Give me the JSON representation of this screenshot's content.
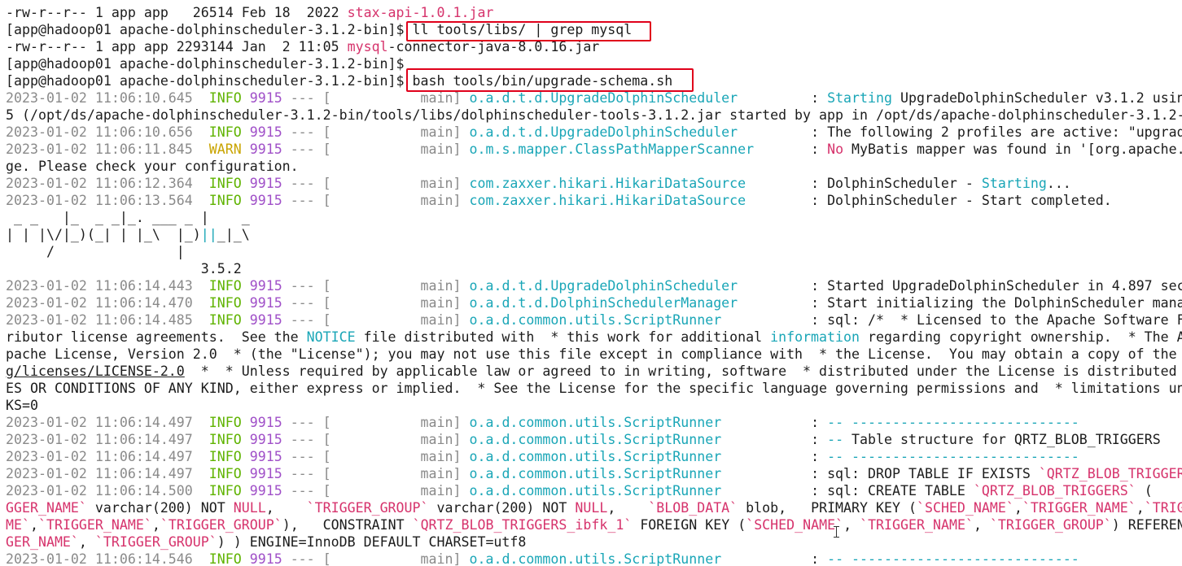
{
  "terminal": {
    "lines": [
      [
        {
          "t": "-rw-r--r-- 1 app app   26514 Feb 18  2022 "
        },
        {
          "t": "stax-api-1.0.1.jar",
          "c": "red"
        }
      ],
      [
        {
          "t": "[app@hadoop01 apache-dolphinscheduler-3.1.2-bin]$ "
        },
        {
          "t": "ll tools/libs/ | grep mysql"
        }
      ],
      [
        {
          "t": "-rw-r--r-- 1 app app 2293144 Jan  2 11:05 "
        },
        {
          "t": "mysql",
          "c": "red"
        },
        {
          "t": "-connector-java-8.0.16.jar"
        }
      ],
      [
        {
          "t": "[app@hadoop01 apache-dolphinscheduler-3.1.2-bin]$"
        }
      ],
      [
        {
          "t": "[app@hadoop01 apache-dolphinscheduler-3.1.2-bin]$ "
        },
        {
          "t": "bash tools/bin/upgrade-schema.sh"
        }
      ],
      [
        {
          "t": "2023-01-02 11:06:10.645  ",
          "c": "gray"
        },
        {
          "t": "INFO",
          "c": "info"
        },
        {
          "t": " "
        },
        {
          "t": "9915",
          "c": "pid"
        },
        {
          "t": " --- [           main] ",
          "c": "gray"
        },
        {
          "t": "o.a.d.t.d.UpgradeDolphinScheduler        ",
          "c": "cyan"
        },
        {
          "t": " : "
        },
        {
          "t": "Starting",
          "c": "cyan"
        },
        {
          "t": " UpgradeDolphinScheduler v3.1.2 using"
        }
      ],
      [
        {
          "t": "5 (/opt/ds/apache-dolphinscheduler-3.1.2-bin/tools/libs/dolphinscheduler-tools-3.1.2.jar started by app in /opt/ds/apache-dolphinscheduler-3.1.2-"
        }
      ],
      [
        {
          "t": "2023-01-02 11:06:10.656  ",
          "c": "gray"
        },
        {
          "t": "INFO",
          "c": "info"
        },
        {
          "t": " "
        },
        {
          "t": "9915",
          "c": "pid"
        },
        {
          "t": " --- [           main] ",
          "c": "gray"
        },
        {
          "t": "o.a.d.t.d.UpgradeDolphinScheduler        ",
          "c": "cyan"
        },
        {
          "t": " : The following 2 profiles are active: \"upgrade"
        }
      ],
      [
        {
          "t": "2023-01-02 11:06:11.845  ",
          "c": "gray"
        },
        {
          "t": "WARN",
          "c": "warn"
        },
        {
          "t": " "
        },
        {
          "t": "9915",
          "c": "pid"
        },
        {
          "t": " --- [           main] ",
          "c": "gray"
        },
        {
          "t": "o.m.s.mapper.ClassPathMapperScanner      ",
          "c": "cyan"
        },
        {
          "t": " : "
        },
        {
          "t": "No",
          "c": "red"
        },
        {
          "t": " MyBatis mapper was found in '[org.apache.d"
        }
      ],
      [
        {
          "t": "ge. Please check your configuration."
        }
      ],
      [
        {
          "t": "2023-01-02 11:06:12.364  ",
          "c": "gray"
        },
        {
          "t": "INFO",
          "c": "info"
        },
        {
          "t": " "
        },
        {
          "t": "9915",
          "c": "pid"
        },
        {
          "t": " --- [           main] ",
          "c": "gray"
        },
        {
          "t": "com.zaxxer.hikari.HikariDataSource       ",
          "c": "cyan"
        },
        {
          "t": " : DolphinScheduler - "
        },
        {
          "t": "Starting",
          "c": "cyan"
        },
        {
          "t": "..."
        }
      ],
      [
        {
          "t": "2023-01-02 11:06:13.564  ",
          "c": "gray"
        },
        {
          "t": "INFO",
          "c": "info"
        },
        {
          "t": " "
        },
        {
          "t": "9915",
          "c": "pid"
        },
        {
          "t": " --- [           main] ",
          "c": "gray"
        },
        {
          "t": "com.zaxxer.hikari.HikariDataSource       ",
          "c": "cyan"
        },
        {
          "t": " : DolphinScheduler - Start completed."
        }
      ],
      [
        {
          "t": " _ _   |_  _ _|_. ___ _ |    _"
        }
      ],
      [
        {
          "t": "| | |\\/|_)(_| | |_\\  |_)"
        },
        {
          "t": "||",
          "c": "cyan"
        },
        {
          "t": "_|_\\"
        }
      ],
      [
        {
          "t": "     /               |"
        }
      ],
      [
        {
          "t": "                        3.5.2"
        }
      ],
      [
        {
          "t": "2023-01-02 11:06:14.443  ",
          "c": "gray"
        },
        {
          "t": "INFO",
          "c": "info"
        },
        {
          "t": " "
        },
        {
          "t": "9915",
          "c": "pid"
        },
        {
          "t": " --- [           main] ",
          "c": "gray"
        },
        {
          "t": "o.a.d.t.d.UpgradeDolphinScheduler        ",
          "c": "cyan"
        },
        {
          "t": " : Started UpgradeDolphinScheduler in 4.897 seco"
        }
      ],
      [
        {
          "t": "2023-01-02 11:06:14.470  ",
          "c": "gray"
        },
        {
          "t": "INFO",
          "c": "info"
        },
        {
          "t": " "
        },
        {
          "t": "9915",
          "c": "pid"
        },
        {
          "t": " --- [           main] ",
          "c": "gray"
        },
        {
          "t": "o.a.d.t.d.DolphinSchedulerManager        ",
          "c": "cyan"
        },
        {
          "t": " : Start initializing the DolphinScheduler manag"
        }
      ],
      [
        {
          "t": "2023-01-02 11:06:14.485  ",
          "c": "gray"
        },
        {
          "t": "INFO",
          "c": "info"
        },
        {
          "t": " "
        },
        {
          "t": "9915",
          "c": "pid"
        },
        {
          "t": " --- [           main] ",
          "c": "gray"
        },
        {
          "t": "o.a.d.common.utils.ScriptRunner          ",
          "c": "cyan"
        },
        {
          "t": " : sql: /*  * Licensed to the Apache Software Fo"
        }
      ],
      [
        {
          "t": "ributor license agreements.  See the "
        },
        {
          "t": "NOTICE",
          "c": "cyan"
        },
        {
          "t": " file distributed with  * this work for additional "
        },
        {
          "t": "information",
          "c": "cyan"
        },
        {
          "t": " regarding copyright ownership.  * The A"
        }
      ],
      [
        {
          "t": "pache License, Version 2.0  * (the \"License\"); you may not use this file except in compliance with  * the License.  You may obtain a copy of the"
        }
      ],
      [
        {
          "t": "g/licenses/LICENSE-2.0",
          "c": "ul"
        },
        {
          "t": "  *  * Unless required by applicable law or agreed to in writing, software  * distributed under the License is distributed"
        }
      ],
      [
        {
          "t": "ES OR CONDITIONS OF ANY KIND, either express or implied.  * See the License for the specific language governing permissions and  * limitations un"
        }
      ],
      [
        {
          "t": "KS=0"
        }
      ],
      [
        {
          "t": "2023-01-02 11:06:14.497  ",
          "c": "gray"
        },
        {
          "t": "INFO",
          "c": "info"
        },
        {
          "t": " "
        },
        {
          "t": "9915",
          "c": "pid"
        },
        {
          "t": " --- [           main] ",
          "c": "gray"
        },
        {
          "t": "o.a.d.common.utils.ScriptRunner          ",
          "c": "cyan"
        },
        {
          "t": " : "
        },
        {
          "t": "-- ----------------------------",
          "c": "cyan"
        }
      ],
      [
        {
          "t": "2023-01-02 11:06:14.497  ",
          "c": "gray"
        },
        {
          "t": "INFO",
          "c": "info"
        },
        {
          "t": " "
        },
        {
          "t": "9915",
          "c": "pid"
        },
        {
          "t": " --- [           main] ",
          "c": "gray"
        },
        {
          "t": "o.a.d.common.utils.ScriptRunner          ",
          "c": "cyan"
        },
        {
          "t": " : "
        },
        {
          "t": "--",
          "c": "cyan"
        },
        {
          "t": " Table structure for QRTZ_BLOB_TRIGGERS"
        }
      ],
      [
        {
          "t": "2023-01-02 11:06:14.497  ",
          "c": "gray"
        },
        {
          "t": "INFO",
          "c": "info"
        },
        {
          "t": " "
        },
        {
          "t": "9915",
          "c": "pid"
        },
        {
          "t": " --- [           main] ",
          "c": "gray"
        },
        {
          "t": "o.a.d.common.utils.ScriptRunner          ",
          "c": "cyan"
        },
        {
          "t": " : "
        },
        {
          "t": "-- ----------------------------",
          "c": "cyan"
        }
      ],
      [
        {
          "t": "2023-01-02 11:06:14.497  ",
          "c": "gray"
        },
        {
          "t": "INFO",
          "c": "info"
        },
        {
          "t": " "
        },
        {
          "t": "9915",
          "c": "pid"
        },
        {
          "t": " --- [           main] ",
          "c": "gray"
        },
        {
          "t": "o.a.d.common.utils.ScriptRunner          ",
          "c": "cyan"
        },
        {
          "t": " : sql: DROP TABLE IF EXISTS "
        },
        {
          "t": "`QRTZ_BLOB_TRIGGERS`",
          "c": "red"
        }
      ],
      [
        {
          "t": "2023-01-02 11:06:14.500  ",
          "c": "gray"
        },
        {
          "t": "INFO",
          "c": "info"
        },
        {
          "t": " "
        },
        {
          "t": "9915",
          "c": "pid"
        },
        {
          "t": " --- [           main] ",
          "c": "gray"
        },
        {
          "t": "o.a.d.common.utils.ScriptRunner          ",
          "c": "cyan"
        },
        {
          "t": " : sql: CREATE TABLE "
        },
        {
          "t": "`QRTZ_BLOB_TRIGGERS`",
          "c": "red"
        },
        {
          "t": " (    "
        },
        {
          "t": "`S",
          "c": "red"
        }
      ],
      [
        {
          "t": "GGER_NAME`",
          "c": "red"
        },
        {
          "t": " varchar(200) NOT "
        },
        {
          "t": "NULL",
          "c": "red"
        },
        {
          "t": ",    "
        },
        {
          "t": "`TRIGGER_GROUP`",
          "c": "red"
        },
        {
          "t": " varchar(200) NOT "
        },
        {
          "t": "NULL",
          "c": "red"
        },
        {
          "t": ",    "
        },
        {
          "t": "`BLOB_DATA`",
          "c": "red"
        },
        {
          "t": " blob,   PRIMARY KEY ("
        },
        {
          "t": "`SCHED_NAME`",
          "c": "red"
        },
        {
          "t": ","
        },
        {
          "t": "`TRIGGER_NAME`",
          "c": "red"
        },
        {
          "t": ","
        },
        {
          "t": "`TRIGGE",
          "c": "red"
        }
      ],
      [
        {
          "t": "ME`",
          "c": "red"
        },
        {
          "t": ","
        },
        {
          "t": "`TRIGGER_NAME`",
          "c": "red"
        },
        {
          "t": ","
        },
        {
          "t": "`TRIGGER_GROUP`",
          "c": "red"
        },
        {
          "t": "),   CONSTRAINT "
        },
        {
          "t": "`QRTZ_BLOB_TRIGGERS_ibfk_1`",
          "c": "red"
        },
        {
          "t": " FOREIGN KEY ("
        },
        {
          "t": "`SCHED_NAME`",
          "c": "red"
        },
        {
          "t": ", "
        },
        {
          "t": "`TRIGGER_NAME`",
          "c": "red"
        },
        {
          "t": ", "
        },
        {
          "t": "`TRIGGER_GROUP`",
          "c": "red"
        },
        {
          "t": ") REFEREN"
        }
      ],
      [
        {
          "t": "GER_NAME`",
          "c": "red"
        },
        {
          "t": ", "
        },
        {
          "t": "`TRIGGER_GROUP`",
          "c": "red"
        },
        {
          "t": ") ) ENGINE=InnoDB DEFAULT CHARSET=utf8"
        }
      ],
      [
        {
          "t": "2023-01-02 11:06:14.546  ",
          "c": "gray"
        },
        {
          "t": "INFO",
          "c": "info"
        },
        {
          "t": " "
        },
        {
          "t": "9915",
          "c": "pid"
        },
        {
          "t": " --- [           main] ",
          "c": "gray"
        },
        {
          "t": "o.a.d.common.utils.ScriptRunner          ",
          "c": "cyan"
        },
        {
          "t": " : "
        },
        {
          "t": "-- ----------------------------",
          "c": "cyan"
        }
      ]
    ]
  }
}
